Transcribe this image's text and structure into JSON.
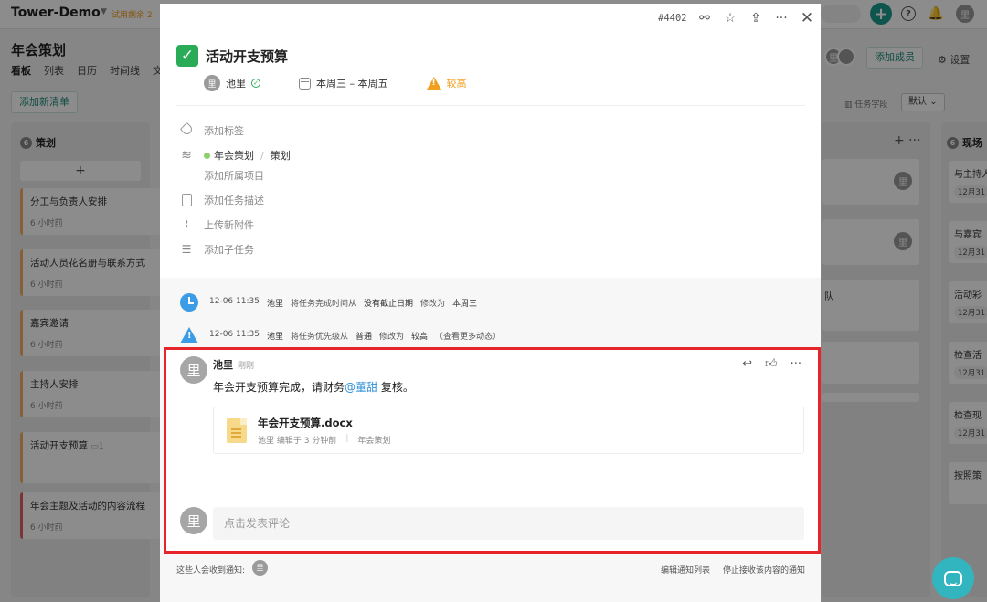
{
  "app": {
    "brand": "Tower-Demo",
    "trial": "试用剩余 2",
    "project_title": "年会策划",
    "views": [
      "看板",
      "列表",
      "日历",
      "时间线",
      "文"
    ],
    "add_member": "添加成员",
    "settings": "设置",
    "add_list": "添加新清单",
    "task_fields": "任务字段",
    "default_view": "默认",
    "avatar_glyph": "里"
  },
  "left_column": {
    "count": "6",
    "title": "策划",
    "add_symbol": "+",
    "cards": [
      {
        "title": "分工与负责人安排",
        "time": "6 小时前"
      },
      {
        "title": "活动人员花名册与联系方式",
        "time": "6 小时前"
      },
      {
        "title": "嘉宾邀请",
        "time": "6 小时前"
      },
      {
        "title": "主持人安排",
        "time": "6 小时前"
      },
      {
        "title": "活动开支预算",
        "time": "1"
      },
      {
        "title": "年会主题及活动的内容流程",
        "time": "6 小时前"
      }
    ]
  },
  "mid_column": {
    "tools": "+ ···",
    "card_text": "队"
  },
  "right_column": {
    "count": "6",
    "title": "现场",
    "cards": [
      {
        "title": "与主持人",
        "date": "12月31"
      },
      {
        "title": "与嘉宾",
        "date": "12月31"
      },
      {
        "title": "活动彩",
        "date": "12月31"
      },
      {
        "title": "检查活",
        "date": "12月31"
      },
      {
        "title": "检查现",
        "date": "12月31"
      },
      {
        "title": "按照策",
        "date": ""
      }
    ]
  },
  "modal": {
    "task_id": "#4402",
    "title": "活动开支预算",
    "assignee": "池里",
    "date_range": "本周三 – 本周五",
    "priority": "较高",
    "add_tag": "添加标签",
    "project": "年会策划",
    "list": "策划",
    "add_project": "添加所属项目",
    "add_description": "添加任务描述",
    "upload_attachment": "上传新附件",
    "add_subtask": "添加子任务"
  },
  "activity": [
    {
      "time": "12-06 11:35",
      "user": "池里",
      "text_a": "将任务完成时间从",
      "from": "没有截止日期",
      "text_b": "修改为",
      "to": "本周三",
      "extra": ""
    },
    {
      "time": "12-06 11:35",
      "user": "池里",
      "text_a": "将任务优先级从",
      "from": "普通",
      "text_b": "修改为",
      "to": "较高",
      "extra": "（查看更多动态）"
    }
  ],
  "comment": {
    "author": "池里",
    "time": "刚刚",
    "text_before": "年会开支预算完成，请财务",
    "mention": "@董甜",
    "text_after": " 复核。",
    "file": {
      "name": "年会开支预算.docx",
      "edited": "池里 编辑于 3 分钟前",
      "project": "年会策划"
    },
    "reply_placeholder": "点击发表评论"
  },
  "notify": {
    "label": "这些人会收到通知:",
    "edit_list": "编辑通知列表",
    "stop": "停止接收该内容的通知"
  },
  "colors": {
    "accent": "#1e9c8c",
    "done_green": "#2aab58",
    "priority_orange": "#f0a020",
    "activity_blue": "#3c9ce6",
    "highlight_red": "#e5252a",
    "mention_blue": "#2f8fd8"
  }
}
